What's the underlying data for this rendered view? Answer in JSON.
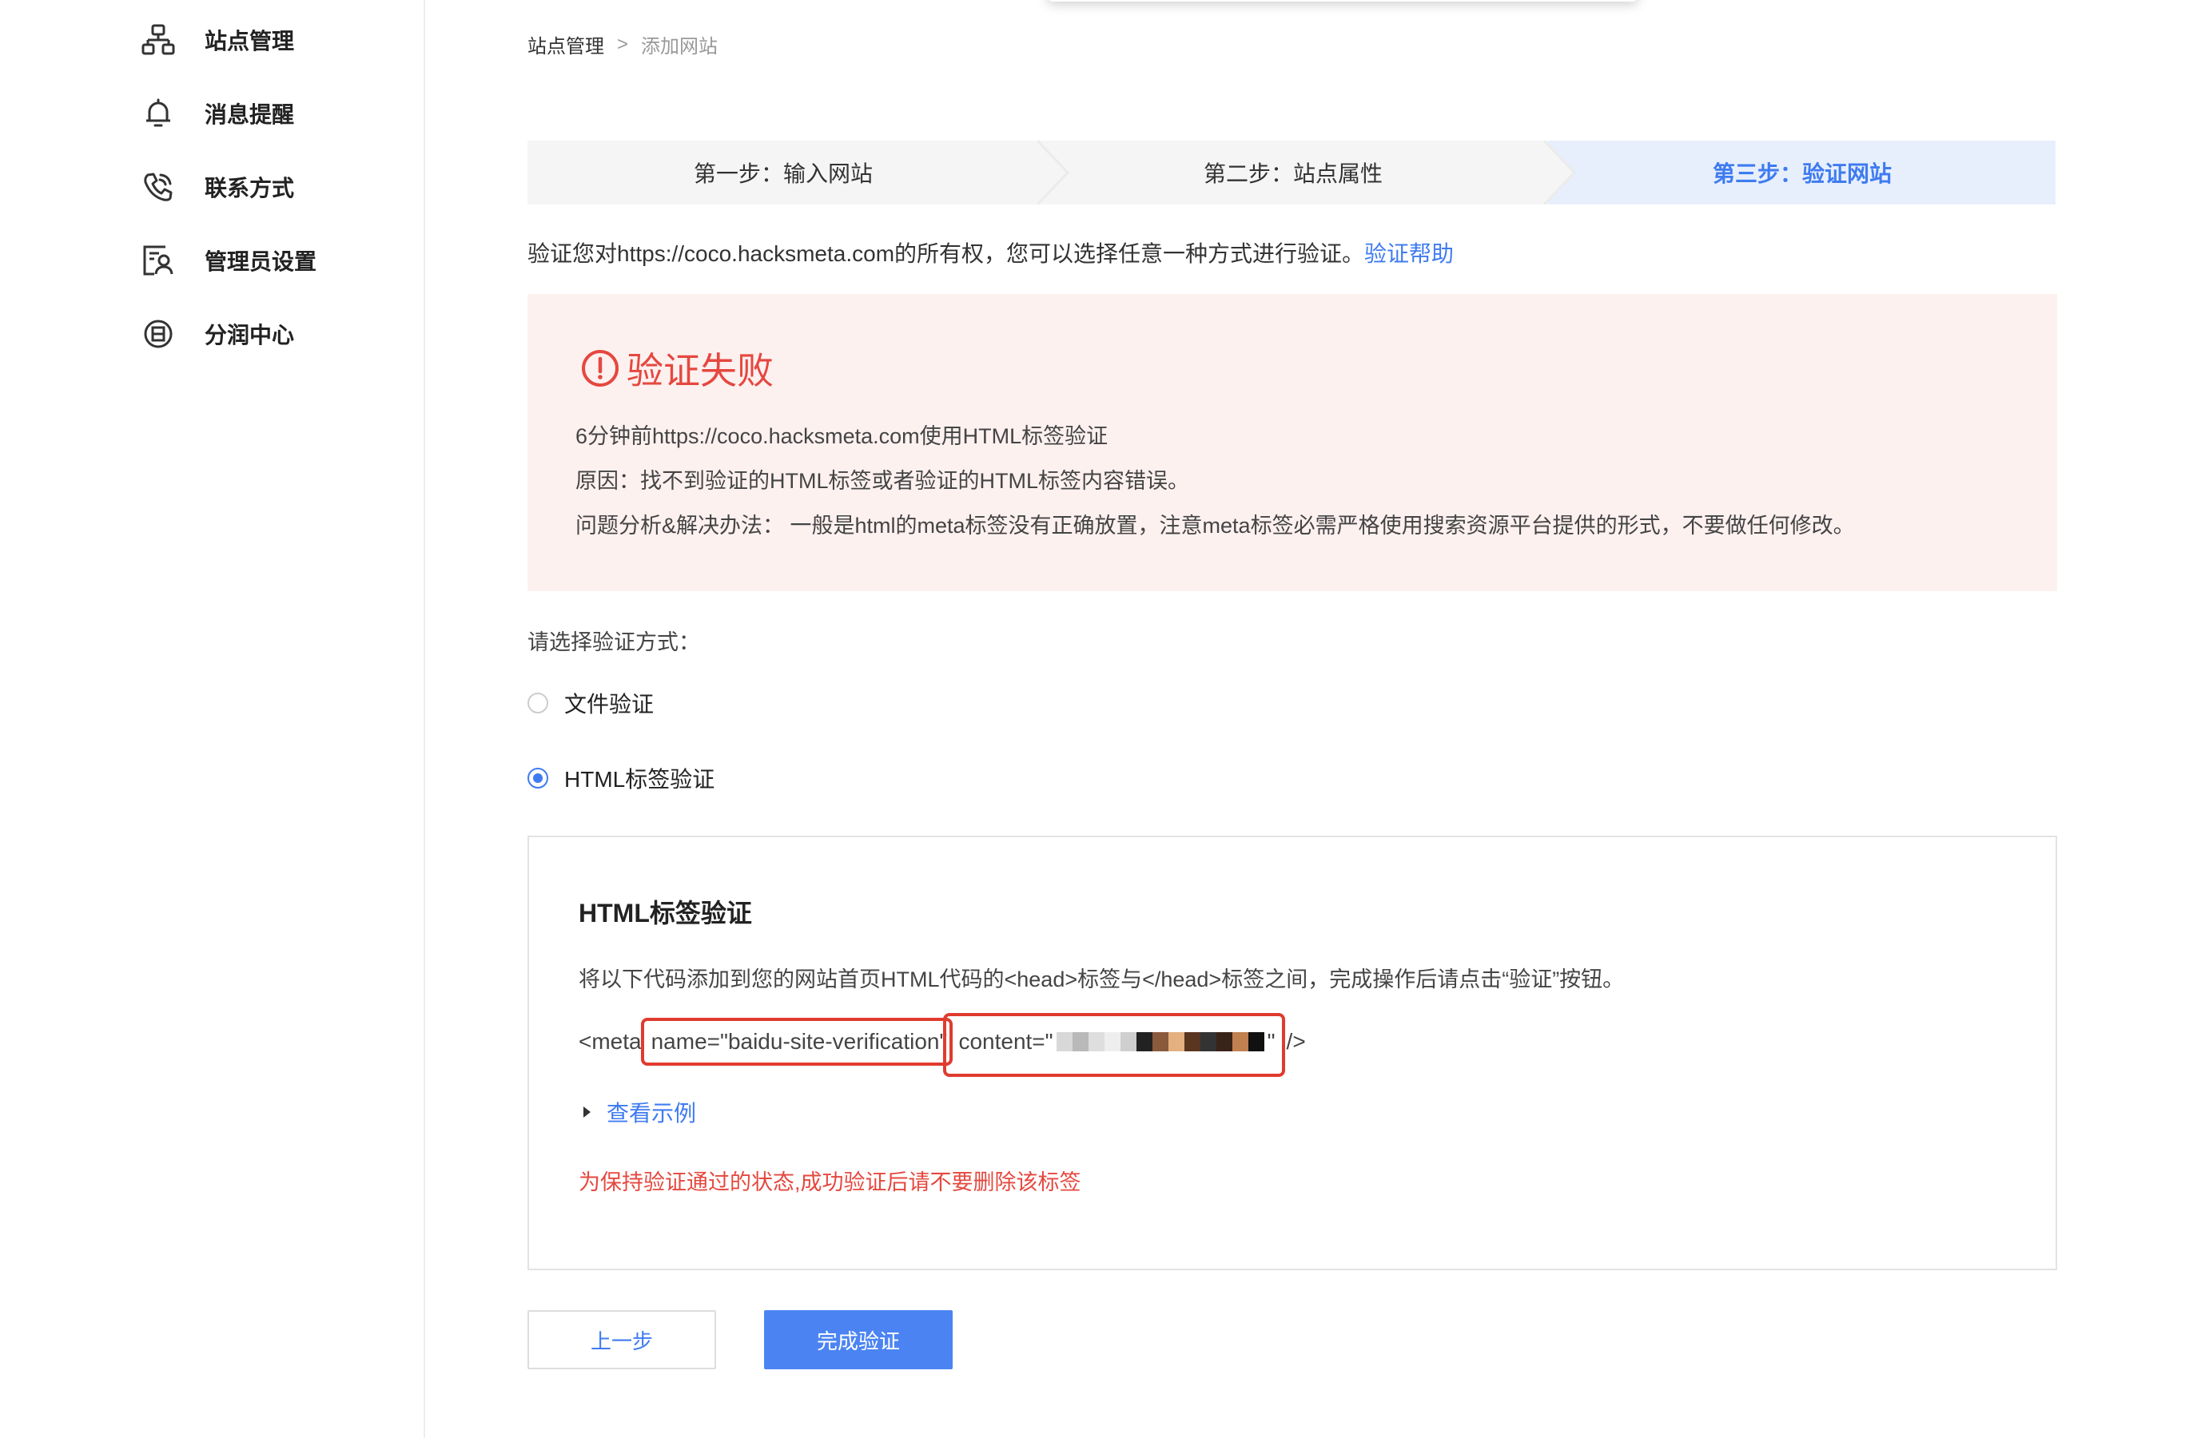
{
  "sidebar": {
    "items": [
      {
        "label": "站点管理",
        "icon": "sitemap-icon"
      },
      {
        "label": "消息提醒",
        "icon": "bell-icon"
      },
      {
        "label": "联系方式",
        "icon": "phone-icon"
      },
      {
        "label": "管理员设置",
        "icon": "admin-user-icon"
      },
      {
        "label": "分润中心",
        "icon": "revenue-icon"
      }
    ]
  },
  "breadcrumb": {
    "root": "站点管理",
    "separator": ">",
    "current": "添加网站"
  },
  "steps": [
    {
      "label": "第一步：输入网站",
      "active": false
    },
    {
      "label": "第二步：站点属性",
      "active": false
    },
    {
      "label": "第三步：验证网站",
      "active": true
    }
  ],
  "intro": {
    "text": "验证您对https://coco.hacksmeta.com的所有权，您可以选择任意一种方式进行验证。",
    "help_link": "验证帮助"
  },
  "error": {
    "title": "验证失败",
    "line1": "6分钟前https://coco.hacksmeta.com使用HTML标签验证",
    "line2": "原因：找不到验证的HTML标签或者验证的HTML标签内容错误。",
    "line3": "问题分析&解决办法： 一般是html的meta标签没有正确放置，注意meta标签必需严格使用搜索资源平台提供的形式，不要做任何修改。"
  },
  "method": {
    "label": "请选择验证方式：",
    "options": [
      {
        "label": "文件验证",
        "checked": false
      },
      {
        "label": "HTML标签验证",
        "checked": true
      }
    ]
  },
  "html_verify": {
    "title": "HTML标签验证",
    "description": "将以下代码添加到您的网站首页HTML代码的<head>标签与</head>标签之间，完成操作后请点击“验证”按钮。",
    "code_prefix": "<meta",
    "code_name": "name=\"baidu-site-verification\"",
    "code_content_start": "content=\"",
    "code_content_end": "\"",
    "code_suffix": "/>",
    "example_link": "查看示例",
    "keep_note": "为保持验证通过的状态,成功验证后请不要删除该标签"
  },
  "buttons": {
    "prev": "上一步",
    "finish": "完成验证"
  },
  "colors": {
    "accent": "#3f7bf0",
    "error": "#e5483f",
    "error_bg": "#fdf1f0",
    "highlight_box": "#e03b2f"
  }
}
